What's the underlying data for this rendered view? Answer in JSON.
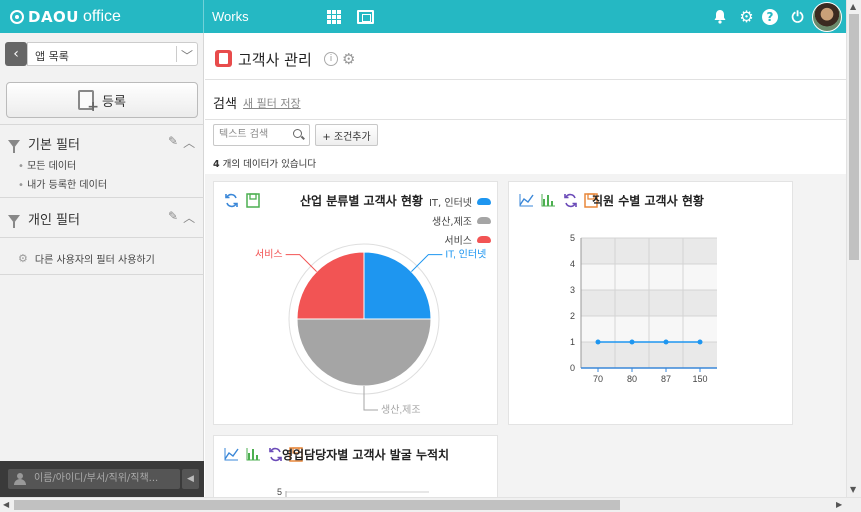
{
  "topbar": {
    "logo_brand": "DAOU",
    "logo_office": "office",
    "nav_label": "Works",
    "colors": {
      "bar": "#25b8c3"
    },
    "icons": [
      "apps-grid-icon",
      "media-icon",
      "bell-icon",
      "gear-icon",
      "help-icon",
      "power-icon",
      "avatar"
    ]
  },
  "sidebar": {
    "app_select": "앱 목록",
    "register_label": "등록",
    "basic_filter": {
      "title": "기본 필터",
      "items": [
        "모든 데이터",
        "내가 등록한 데이터"
      ]
    },
    "personal_filter": {
      "title": "개인 필터"
    },
    "use_others_filter": "다른 사용자의 필터 사용하기",
    "people_search_placeholder": "이름/아이디/부서/직위/직책..."
  },
  "main": {
    "title": "고객사 관리",
    "search_label": "검색",
    "save_filter_link": "새 필터 저장",
    "text_search_placeholder": "텍스트 검색",
    "add_condition": "+ 조건추가",
    "count_number": "4",
    "count_suffix": "개의 데이터가 있습니다"
  },
  "chart_data": [
    {
      "type": "pie",
      "title": "산업 분류별 고객사 현황",
      "categories": [
        "IT, 인터넷",
        "생산,제조",
        "서비스"
      ],
      "values": [
        1,
        2,
        1
      ],
      "colors": [
        "#1e96f0",
        "#a5a5a5",
        "#f25454"
      ],
      "legend": "top-right"
    },
    {
      "type": "line",
      "title": "직원 수별 고객사 현황",
      "categories": [
        "70",
        "80",
        "87",
        "150"
      ],
      "values": [
        1,
        1,
        1,
        1
      ],
      "ylim": [
        0,
        5
      ],
      "yticks": [
        "0",
        "1",
        "2",
        "3",
        "4",
        "5"
      ],
      "grid": true,
      "color": "#1e96f0"
    },
    {
      "type": "line",
      "title": "영업담당자별 고객사 발굴 누적치",
      "yticks_visible": [
        "5"
      ]
    }
  ]
}
